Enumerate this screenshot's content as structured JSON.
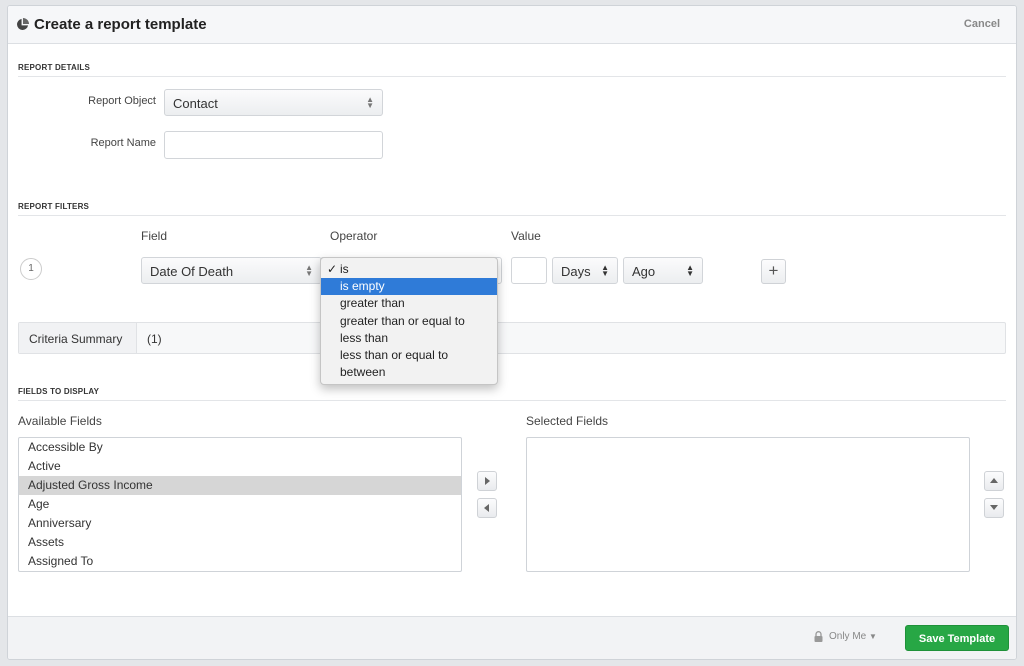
{
  "header": {
    "title": "Create a report template",
    "cancel_label": "Cancel"
  },
  "report_details": {
    "section_label": "REPORT DETAILS",
    "report_object_label": "Report Object",
    "report_object_value": "Contact",
    "report_name_label": "Report Name",
    "report_name_value": ""
  },
  "report_filters": {
    "section_label": "REPORT FILTERS",
    "col_field": "Field",
    "col_operator": "Operator",
    "col_value": "Value",
    "row_number": "1",
    "field_value": "Date Of Death",
    "operator_value": "is",
    "value_input": "",
    "unit_value": "Days",
    "direction_value": "Ago",
    "operator_options": [
      {
        "label": "is",
        "checked": true
      },
      {
        "label": "is empty",
        "highlighted": true
      },
      {
        "label": "greater than"
      },
      {
        "label": "greater than or equal to"
      },
      {
        "label": "less than"
      },
      {
        "label": "less than or equal to"
      },
      {
        "label": "between"
      }
    ]
  },
  "criteria": {
    "label": "Criteria Summary",
    "value": "(1)"
  },
  "fields_to_display": {
    "section_label": "FIELDS TO DISPLAY",
    "available_label": "Available Fields",
    "selected_label": "Selected Fields",
    "available": [
      "Accessible By",
      "Active",
      "Adjusted Gross Income",
      "Age",
      "Anniversary",
      "Assets",
      "Assigned To"
    ],
    "selected_index": 2,
    "selected": []
  },
  "footer": {
    "visibility": "Only Me",
    "save_label": "Save Template"
  },
  "colors": {
    "save": "#27a745",
    "highlight": "#2f7bd8"
  }
}
